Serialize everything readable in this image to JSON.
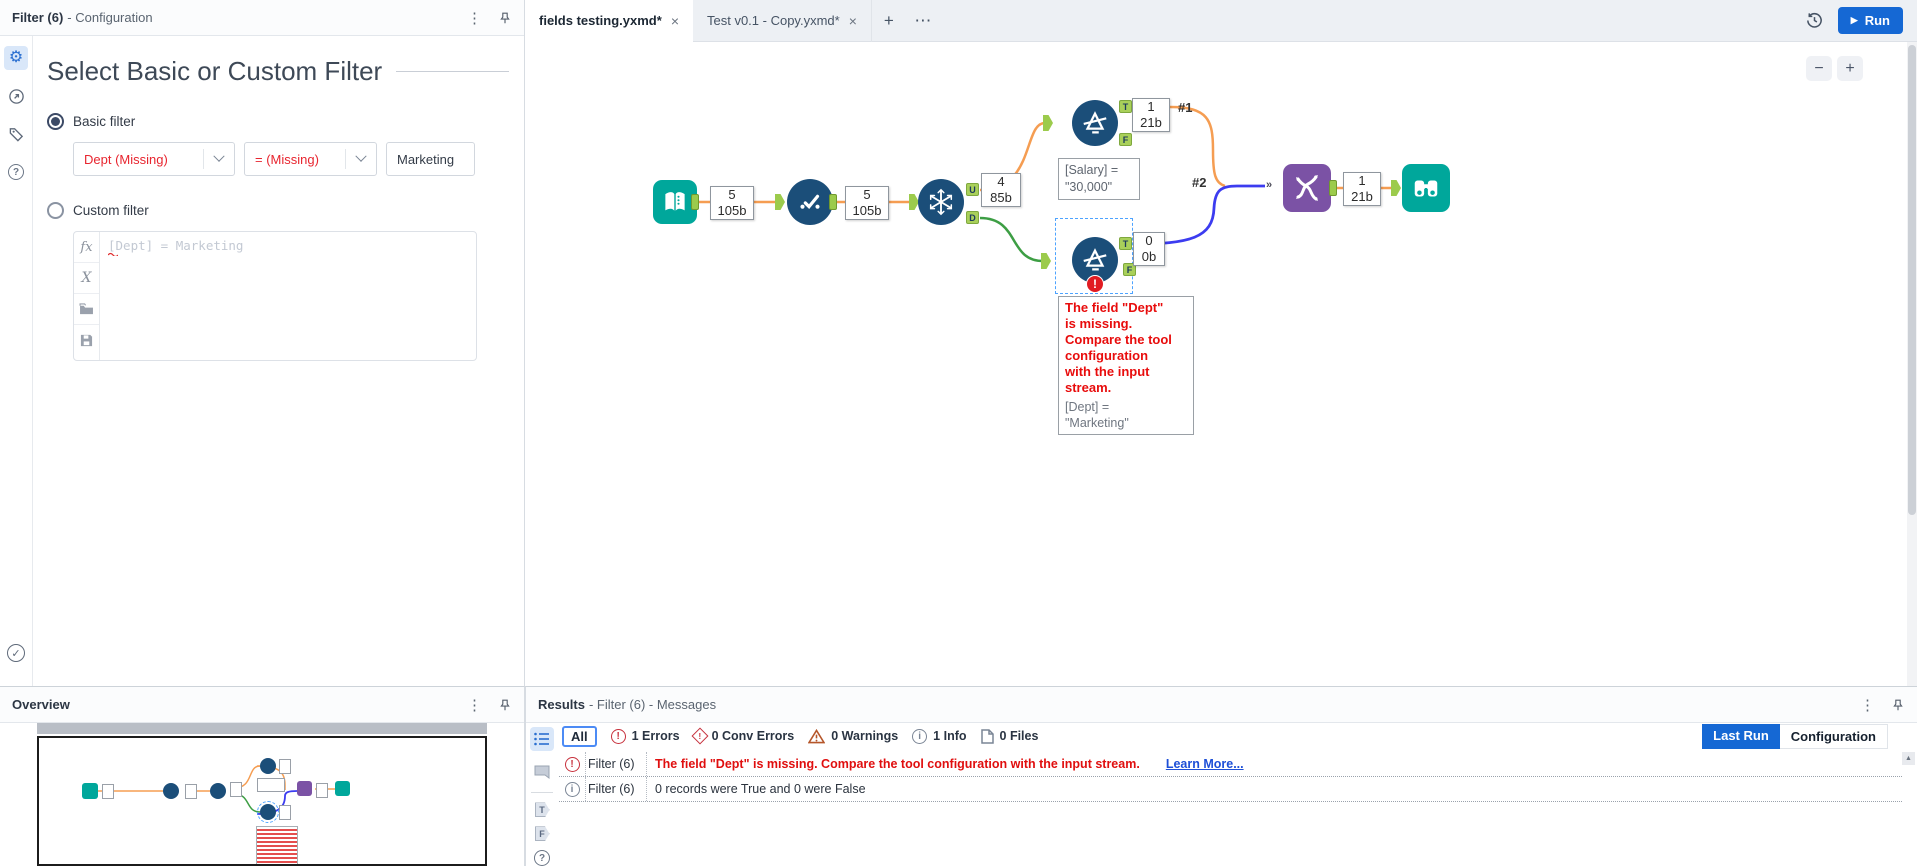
{
  "config": {
    "title_bold": "Filter (6)",
    "title_rest": "- Configuration",
    "heading": "Select Basic or Custom Filter",
    "basic_label": "Basic filter",
    "custom_label": "Custom filter",
    "field_value": "Dept (Missing)",
    "operator_value": "= (Missing)",
    "value_text": "Marketing",
    "expression_placeholder": "[Dept] = Marketing",
    "fx_label": "fx",
    "x_label": "X"
  },
  "tabs": {
    "tab1": "fields testing.yxmd*",
    "tab2": "Test v0.1 - Copy.yxmd*",
    "run_label": "Run"
  },
  "icons": {
    "kebab": "⋮",
    "close": "×",
    "plus": "+",
    "ellipsis": "⋯",
    "minus": "−",
    "zoom_in": "+",
    "play": "▶",
    "gear": "⚙",
    "check": "✓",
    "question": "?",
    "info": "i",
    "error": "!",
    "merge": "»",
    "scroll_up": "▲"
  },
  "canvas": {
    "badges": [
      {
        "count": "5",
        "size": "105b"
      },
      {
        "count": "5",
        "size": "105b"
      },
      {
        "count": "4",
        "size": "85b"
      },
      {
        "count": "1",
        "size": "21b"
      },
      {
        "count": "0",
        "size": "0b"
      },
      {
        "count": "1",
        "size": "21b"
      }
    ],
    "anchors": {
      "t": "T",
      "f": "F",
      "u": "U",
      "d": "D"
    },
    "conn1": "#1",
    "conn2": "#2",
    "salary_note": {
      "line1": "[Salary] =",
      "line2": "\"30,000\""
    },
    "error_note": {
      "err_lines": [
        "The field \"Dept\"",
        "is missing.",
        "Compare the tool",
        "configuration",
        "with the input",
        "stream."
      ],
      "expr_lines": [
        "[Dept] =",
        "\"Marketing\""
      ]
    }
  },
  "overview": {
    "title": "Overview"
  },
  "results": {
    "title_bold": "Results",
    "title_rest": "- Filter (6) - Messages",
    "all_label": "All",
    "filters": [
      {
        "label": "1 Errors"
      },
      {
        "label": "0 Conv Errors"
      },
      {
        "label": "0 Warnings"
      },
      {
        "label": "1 Info"
      },
      {
        "label": "0 Files"
      }
    ],
    "last_run": "Last Run",
    "configuration": "Configuration",
    "rows": [
      {
        "source": "Filter (6)",
        "message": "The field \"Dept\" is missing. Compare the tool configuration with the input stream.",
        "link": "Learn More..."
      },
      {
        "source": "Filter (6)",
        "message": "0 records were True and 0 were False",
        "link": ""
      }
    ]
  },
  "colors": {
    "tool_blue": "#1b4e79",
    "teal": "#00a79b",
    "purple": "#7b52a5",
    "wire_orange": "#f59d52",
    "wire_green": "#3d9e44",
    "wire_blue": "#3c3cf0",
    "anchor_green": "#9ccb4c",
    "error_red": "#e11b22",
    "accent_blue": "#1568d4"
  }
}
